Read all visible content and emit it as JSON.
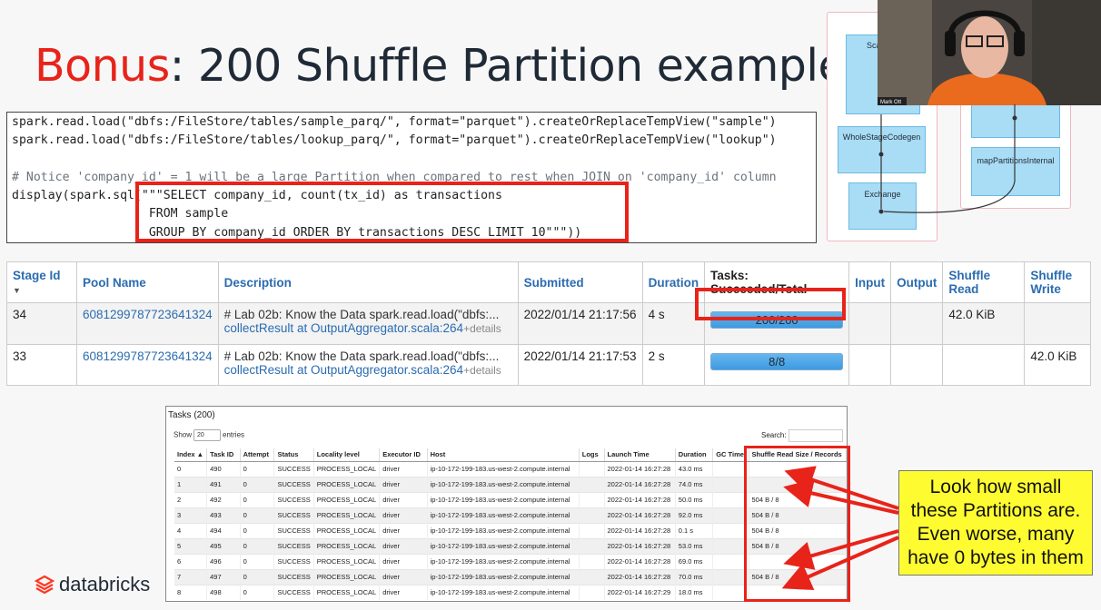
{
  "slide": {
    "title_accent": "Bonus",
    "title_rest": ": 200 Shuffle Partition example"
  },
  "code": {
    "lines": [
      "spark.read.load(\"dbfs:/FileStore/tables/sample_parq/\", format=\"parquet\").createOrReplaceTempView(\"sample\")",
      "spark.read.load(\"dbfs:/FileStore/tables/lookup_parq/\", format=\"parquet\").createOrReplaceTempView(\"lookup\")",
      "",
      "# Notice 'company_id' = 1 will be a large Partition when compared to rest when JOIN on 'company_id' column",
      "display(spark.sql(\"\"\"SELECT company_id, count(tx_id) as transactions",
      "                   FROM sample",
      "                   GROUP BY company_id ORDER BY transactions DESC LIMIT 10\"\"\"))"
    ]
  },
  "dag": {
    "nodes": [
      "Sca",
      "WholeStageCodegen",
      "Exchange",
      "mapPartitionsInternal"
    ],
    "webcam_name": "Mark Ott"
  },
  "stages": {
    "headers": [
      "Stage Id",
      "Pool Name",
      "Description",
      "Submitted",
      "Duration",
      "Tasks: Succeeded/Total",
      "Input",
      "Output",
      "Shuffle Read",
      "Shuffle Write"
    ],
    "sort_indicator": "▼",
    "rows": [
      {
        "id": "34",
        "pool": "6081299787723641324",
        "desc1": "# Lab 02b: Know the Data spark.read.load(\"dbfs:...",
        "desc2": "collectResult at OutputAggregator.scala:264",
        "details": "+details",
        "submitted": "2022/01/14 21:17:56",
        "duration": "4 s",
        "tasks": "200/200",
        "input": "",
        "output": "",
        "shuffle_read": "42.0 KiB",
        "shuffle_write": ""
      },
      {
        "id": "33",
        "pool": "6081299787723641324",
        "desc1": "# Lab 02b: Know the Data spark.read.load(\"dbfs:...",
        "desc2": "collectResult at OutputAggregator.scala:264",
        "details": "+details",
        "submitted": "2022/01/14 21:17:53",
        "duration": "2 s",
        "tasks": "8/8",
        "input": "",
        "output": "",
        "shuffle_read": "",
        "shuffle_write": "42.0 KiB"
      }
    ]
  },
  "tasks": {
    "title": "Tasks (200)",
    "show_label": "Show",
    "show_value": "20",
    "entries_label": "entries",
    "search_label": "Search:",
    "headers": [
      "Index ▲",
      "Task ID",
      "Attempt",
      "Status",
      "Locality level",
      "Executor ID",
      "Host",
      "Logs",
      "Launch Time",
      "Duration",
      "GC Time",
      "Shuffle Read Size / Records"
    ],
    "rows": [
      [
        "0",
        "490",
        "0",
        "SUCCESS",
        "PROCESS_LOCAL",
        "driver",
        "ip-10-172-199-183.us-west-2.compute.internal",
        "",
        "2022-01-14 16:27:28",
        "43.0 ms",
        "",
        ""
      ],
      [
        "1",
        "491",
        "0",
        "SUCCESS",
        "PROCESS_LOCAL",
        "driver",
        "ip-10-172-199-183.us-west-2.compute.internal",
        "",
        "2022-01-14 16:27:28",
        "74.0 ms",
        "",
        ""
      ],
      [
        "2",
        "492",
        "0",
        "SUCCESS",
        "PROCESS_LOCAL",
        "driver",
        "ip-10-172-199-183.us-west-2.compute.internal",
        "",
        "2022-01-14 16:27:28",
        "50.0 ms",
        "",
        "504 B / 8"
      ],
      [
        "3",
        "493",
        "0",
        "SUCCESS",
        "PROCESS_LOCAL",
        "driver",
        "ip-10-172-199-183.us-west-2.compute.internal",
        "",
        "2022-01-14 16:27:28",
        "92.0 ms",
        "",
        "504 B / 8"
      ],
      [
        "4",
        "494",
        "0",
        "SUCCESS",
        "PROCESS_LOCAL",
        "driver",
        "ip-10-172-199-183.us-west-2.compute.internal",
        "",
        "2022-01-14 16:27:28",
        "0.1 s",
        "",
        "504 B / 8"
      ],
      [
        "5",
        "495",
        "0",
        "SUCCESS",
        "PROCESS_LOCAL",
        "driver",
        "ip-10-172-199-183.us-west-2.compute.internal",
        "",
        "2022-01-14 16:27:28",
        "53.0 ms",
        "",
        "504 B / 8"
      ],
      [
        "6",
        "496",
        "0",
        "SUCCESS",
        "PROCESS_LOCAL",
        "driver",
        "ip-10-172-199-183.us-west-2.compute.internal",
        "",
        "2022-01-14 16:27:28",
        "69.0 ms",
        "",
        ""
      ],
      [
        "7",
        "497",
        "0",
        "SUCCESS",
        "PROCESS_LOCAL",
        "driver",
        "ip-10-172-199-183.us-west-2.compute.internal",
        "",
        "2022-01-14 16:27:28",
        "70.0 ms",
        "",
        "504 B / 8"
      ],
      [
        "8",
        "498",
        "0",
        "SUCCESS",
        "PROCESS_LOCAL",
        "driver",
        "ip-10-172-199-183.us-west-2.compute.internal",
        "",
        "2022-01-14 16:27:29",
        "18.0 ms",
        "",
        ""
      ]
    ]
  },
  "callout": {
    "lines": [
      "Look how small",
      "these Partitions are.",
      "Even worse, many",
      "have 0 bytes in them"
    ]
  },
  "brand": {
    "name": "databricks"
  },
  "colors": {
    "accent_red": "#e8231a",
    "callout_yellow": "#fefc31",
    "link_blue": "#2b6cb0",
    "progress_blue": "#3d9ae0"
  }
}
